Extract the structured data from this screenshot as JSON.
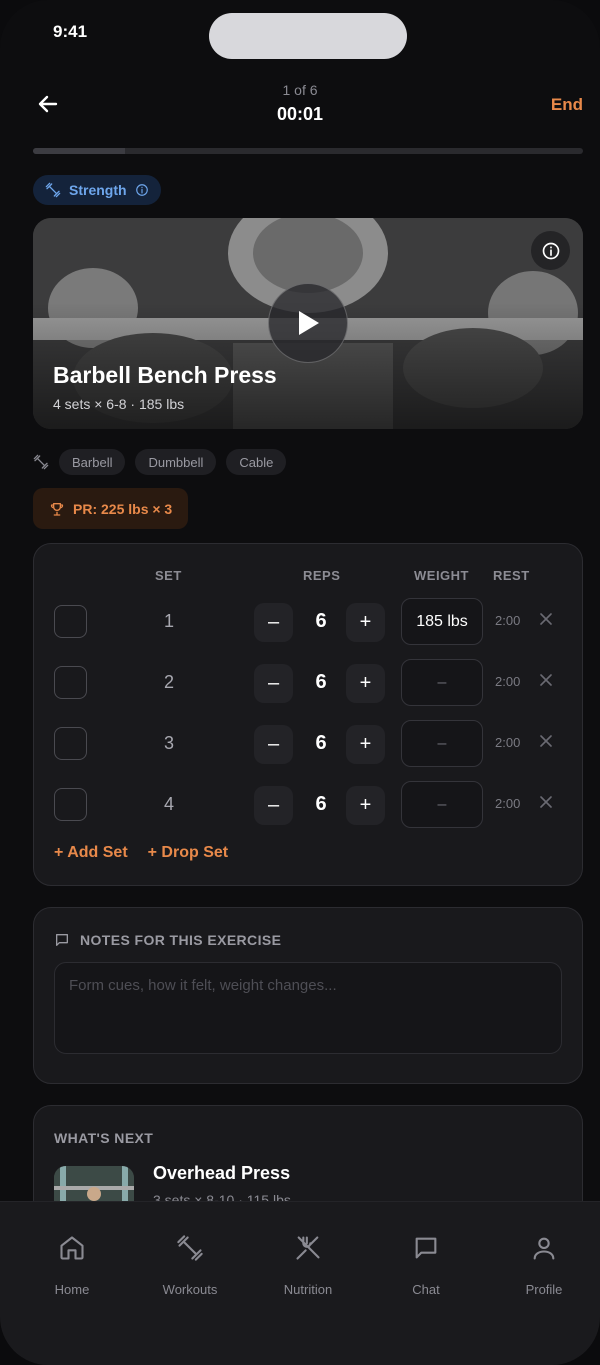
{
  "status_bar": {
    "time": "9:41"
  },
  "header": {
    "progress_label": "1 of 6",
    "timer": "00:01",
    "end_label": "End",
    "workout_progress": 0.1667
  },
  "category": {
    "label": "Strength",
    "color": "#6ea6ec"
  },
  "exercise": {
    "title": "Barbell Bench Press",
    "subtitle": "4 sets × 6-8 · 185 lbs"
  },
  "equipment": [
    "Barbell",
    "Dumbbell",
    "Cable"
  ],
  "personal_record": {
    "label": "PR: 225 lbs × 3"
  },
  "sets_table": {
    "headers": {
      "set": "SET",
      "reps": "REPS",
      "weight": "WEIGHT",
      "rest": "REST"
    },
    "rows": [
      {
        "set": "1",
        "reps": "6",
        "weight_value": "185 lbs",
        "weight_placeholder": "–",
        "rest": "2:00"
      },
      {
        "set": "2",
        "reps": "6",
        "weight_value": "",
        "weight_placeholder": "–",
        "rest": "2:00"
      },
      {
        "set": "3",
        "reps": "6",
        "weight_value": "",
        "weight_placeholder": "–",
        "rest": "2:00"
      },
      {
        "set": "4",
        "reps": "6",
        "weight_value": "",
        "weight_placeholder": "–",
        "rest": "2:00"
      }
    ],
    "minus_label": "–",
    "plus_label": "+",
    "add_set_label": "+ Add Set",
    "drop_set_label": "+ Drop Set"
  },
  "notes": {
    "heading": "NOTES FOR THIS EXERCISE",
    "placeholder": "Form cues, how it felt, weight changes..."
  },
  "whats_next": {
    "heading": "WHAT'S NEXT",
    "title": "Overhead Press",
    "subtitle": "3 sets × 8-10 · 115 lbs"
  },
  "tabbar": {
    "items": [
      {
        "label": "Home",
        "icon": "home-icon"
      },
      {
        "label": "Workouts",
        "icon": "dumbbell-icon"
      },
      {
        "label": "Nutrition",
        "icon": "utensils-icon"
      },
      {
        "label": "Chat",
        "icon": "chat-icon"
      },
      {
        "label": "Profile",
        "icon": "user-icon"
      }
    ]
  },
  "colors": {
    "accent": "#e8894a",
    "background": "#0d0d0f",
    "card": "#19191c",
    "category_bg": "#14233b"
  }
}
